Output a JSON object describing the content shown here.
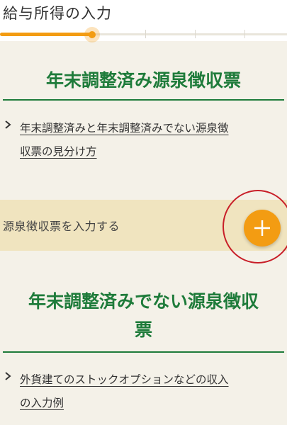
{
  "header": {
    "title": "給与所得の入力"
  },
  "progress": {
    "fraction": 0.32,
    "color": "#f39c12"
  },
  "sections": [
    {
      "heading": "年末調整済み源泉徴収票",
      "link": {
        "line1": "年末調整済みと年末調整済みでない源泉徴",
        "line2": "収票の見分け方"
      }
    },
    {
      "heading_line1": "年末調整済みでない源泉徴収",
      "heading_line2": "票",
      "link": {
        "line1": "外貨建てのストックオプションなどの収入",
        "line2": "の入力例"
      }
    }
  ],
  "input_row": {
    "label": "源泉徴収票を入力する",
    "add_icon": "plus-icon"
  },
  "annotation": {
    "highlight_color": "#c81e28"
  }
}
